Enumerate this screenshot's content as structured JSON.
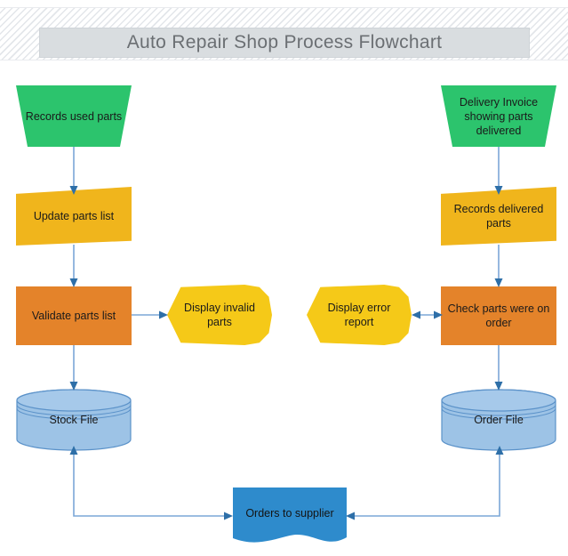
{
  "header": {
    "title": "Auto Repair Shop Process Flowchart",
    "banner_pattern": "diagonal-hatch",
    "title_box_color": "#d9dde0",
    "title_text_color": "#6b6f73"
  },
  "palette": {
    "green": "#2cc46d",
    "yellow_dark": "#f0b51c",
    "yellow_bright": "#f5c918",
    "orange": "#e4832a",
    "cylinder_blue": "#9dc3e6",
    "document_blue": "#2e8bcc",
    "connector_blue": "#7ba7d7",
    "arrow_blue": "#2e6fa8",
    "background": "#ffffff"
  },
  "diagram": {
    "type": "flowchart",
    "nodes": [
      {
        "id": "records-used-parts",
        "label": "Records used parts",
        "shape": "trapezoid",
        "color": "#2cc46d",
        "column": "left"
      },
      {
        "id": "update-parts-list",
        "label": "Update parts list",
        "shape": "skewed-quad",
        "color": "#f0b51c",
        "column": "left"
      },
      {
        "id": "validate-parts-list",
        "label": "Validate parts list",
        "shape": "rectangle",
        "color": "#e4832a",
        "column": "left"
      },
      {
        "id": "display-invalid-parts",
        "label": "Display invalid parts",
        "shape": "display",
        "color": "#f5c918",
        "column": "center-left"
      },
      {
        "id": "stock-file",
        "label": "Stock File",
        "shape": "cylinder",
        "color": "#9dc3e6",
        "column": "left"
      },
      {
        "id": "delivery-invoice",
        "label": "Delivery Invoice showing parts delivered",
        "shape": "trapezoid",
        "color": "#2cc46d",
        "column": "right"
      },
      {
        "id": "records-delivered-parts",
        "label": "Records delivered parts",
        "shape": "skewed-quad",
        "color": "#f0b51c",
        "column": "right"
      },
      {
        "id": "check-parts-were-on-order",
        "label": "Check parts were on order",
        "shape": "rectangle",
        "color": "#e4832a",
        "column": "right"
      },
      {
        "id": "display-error-report",
        "label": "Display error report",
        "shape": "display",
        "color": "#f5c918",
        "column": "center-right"
      },
      {
        "id": "order-file",
        "label": "Order File",
        "shape": "cylinder",
        "color": "#9dc3e6",
        "column": "right"
      },
      {
        "id": "orders-to-supplier",
        "label": "Orders to supplier",
        "shape": "document",
        "color": "#2e8bcc",
        "column": "center"
      }
    ],
    "edges": [
      {
        "from": "records-used-parts",
        "to": "update-parts-list",
        "arrow": "single"
      },
      {
        "from": "update-parts-list",
        "to": "validate-parts-list",
        "arrow": "single"
      },
      {
        "from": "validate-parts-list",
        "to": "display-invalid-parts",
        "arrow": "single"
      },
      {
        "from": "validate-parts-list",
        "to": "stock-file",
        "arrow": "single"
      },
      {
        "from": "delivery-invoice",
        "to": "records-delivered-parts",
        "arrow": "single"
      },
      {
        "from": "records-delivered-parts",
        "to": "check-parts-were-on-order",
        "arrow": "single"
      },
      {
        "from": "check-parts-were-on-order",
        "to": "display-error-report",
        "arrow": "double"
      },
      {
        "from": "check-parts-were-on-order",
        "to": "order-file",
        "arrow": "single"
      },
      {
        "from": "orders-to-supplier",
        "to": "stock-file",
        "arrow": "single"
      },
      {
        "from": "orders-to-supplier",
        "to": "order-file",
        "arrow": "single"
      }
    ]
  },
  "labels": {
    "records_used_parts": "Records used parts",
    "update_parts_list": "Update parts list",
    "validate_parts_list": "Validate parts list",
    "display_invalid_parts_line1": "Display invalid",
    "display_invalid_parts_line2": "parts",
    "stock_file": "Stock File",
    "delivery_invoice_line1": "Delivery Invoice",
    "delivery_invoice_line2": "showing parts",
    "delivery_invoice_line3": "delivered",
    "records_delivered_parts_line1": "Records delivered",
    "records_delivered_parts_line2": "parts",
    "check_parts_line1": "Check parts were on",
    "check_parts_line2": "order",
    "display_error_report_line1": "Display error",
    "display_error_report_line2": "report",
    "order_file": "Order File",
    "orders_to_supplier": "Orders to supplier"
  }
}
